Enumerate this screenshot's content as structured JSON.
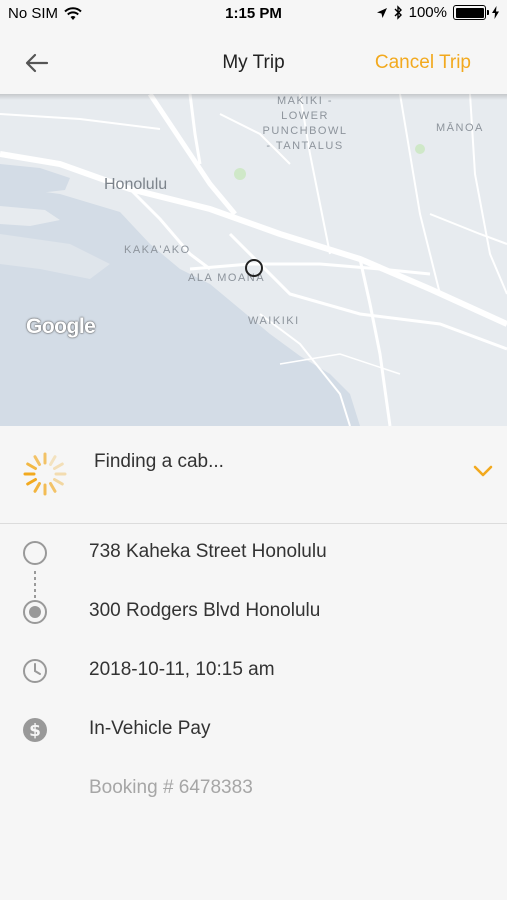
{
  "status_bar": {
    "carrier": "No SIM",
    "time": "1:15 PM",
    "battery_percent": "100%",
    "battery_level": 1.0,
    "icons": [
      "wifi-icon",
      "location-arrow-icon",
      "bluetooth-icon",
      "battery-icon",
      "charging-icon"
    ]
  },
  "nav": {
    "back_icon": "arrow-left-icon",
    "title": "My Trip",
    "cancel_label": "Cancel Trip",
    "accent_color": "#f2a91e"
  },
  "map": {
    "labels": {
      "makiki": "MAKIKI -\nLOWER\nPUNCHBOWL\n- TANTALUS",
      "manoa": "MĀNOA",
      "honolulu": "Honolulu",
      "kakaako": "KAKA'AKO",
      "ala_moana": "ALA MOANA",
      "waikiki": "WAIKIKI"
    },
    "attribution": "Google"
  },
  "trip_status": {
    "text": "Finding a cab...",
    "spinner_icon": "loading-spinner-icon",
    "expand_icon": "chevron-down-icon"
  },
  "details": {
    "pickup": "738 Kaheka Street Honolulu",
    "dropoff": "300 Rodgers Blvd Honolulu",
    "datetime": "2018-10-11, 10:15 am",
    "payment": "In-Vehicle Pay",
    "booking": "Booking # 6478383"
  }
}
